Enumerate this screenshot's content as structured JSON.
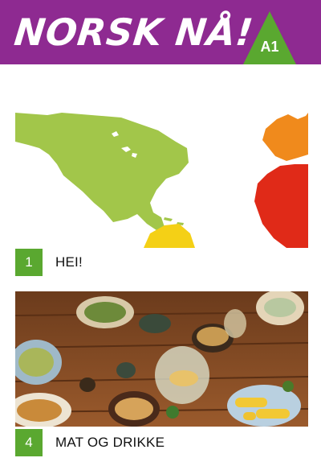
{
  "header": {
    "title": "NORSK NÅ!",
    "level": "A1",
    "colors": {
      "banner": "#8e2a91",
      "badge": "#5aa830"
    }
  },
  "chapters": [
    {
      "number": "1",
      "title": "HEI!",
      "image": "world-map"
    },
    {
      "number": "4",
      "title": "MAT OG DRIKKE",
      "image": "food-table"
    }
  ]
}
